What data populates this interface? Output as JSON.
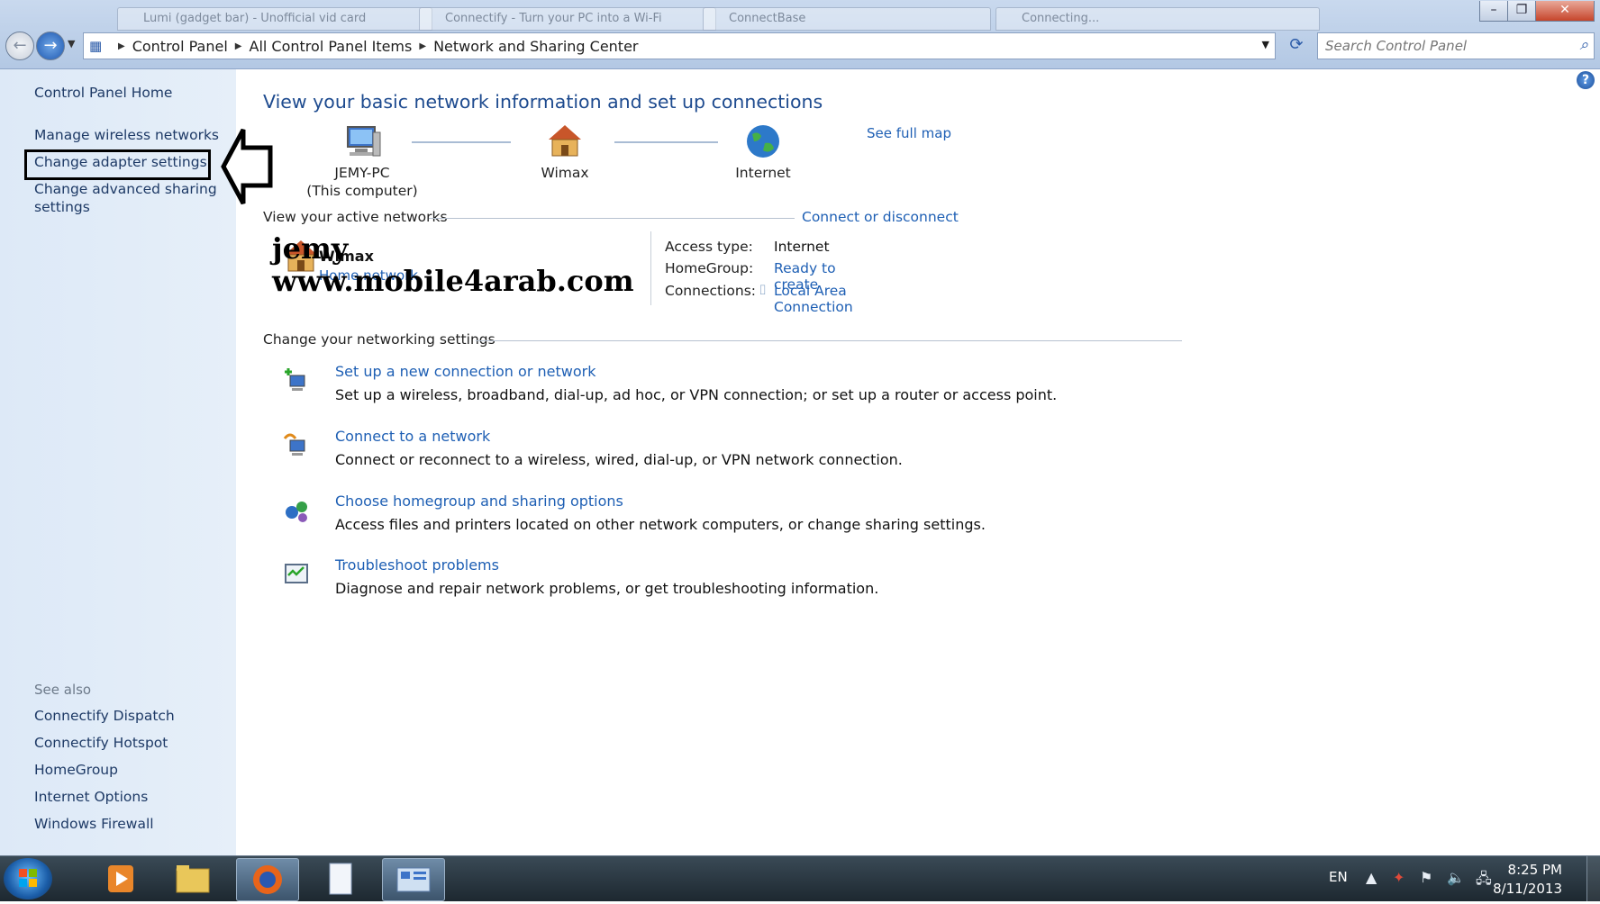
{
  "window": {
    "tabs": [
      "Lumi (gadget bar) - Unofficial vid card",
      "Connectify - Turn your PC into a Wi-Fi",
      "ConnectBase",
      "Connecting..."
    ],
    "minimize": "–",
    "maximize": "❐",
    "close": "✕"
  },
  "address": {
    "crumbs": [
      "Control Panel",
      "All Control Panel Items",
      "Network and Sharing Center"
    ],
    "search_placeholder": "Search Control Panel"
  },
  "sidebar": {
    "home": "Control Panel Home",
    "links": [
      "Manage wireless networks",
      "Change adapter settings",
      "Change advanced sharing",
      "settings"
    ],
    "see_also_title": "See also",
    "see_also": [
      "Connectify Dispatch",
      "Connectify Hotspot",
      "HomeGroup",
      "Internet Options",
      "Windows Firewall"
    ]
  },
  "main": {
    "title": "View your basic network information and set up connections",
    "see_full_map": "See full map",
    "map": {
      "computer_name": "JEMY-PC",
      "computer_sub": "(This computer)",
      "network": "Wimax",
      "internet": "Internet"
    },
    "active_networks_head": "View your active networks",
    "connect_disconnect": "Connect or disconnect",
    "active": {
      "name": "Wimax",
      "type": "Home network",
      "access_type_label": "Access type:",
      "access_type": "Internet",
      "homegroup_label": "HomeGroup:",
      "homegroup": "Ready to create",
      "connections_label": "Connections:",
      "connection": "Local Area Connection"
    },
    "watermark": {
      "line1": "jemy",
      "line2": "www.mobile4arab.com"
    },
    "settings_head": "Change your networking settings",
    "tasks": [
      {
        "title": "Set up a new connection or network",
        "desc": "Set up a wireless, broadband, dial-up, ad hoc, or VPN connection; or set up a router or access point."
      },
      {
        "title": "Connect to a network",
        "desc": "Connect or reconnect to a wireless, wired, dial-up, or VPN network connection."
      },
      {
        "title": "Choose homegroup and sharing options",
        "desc": "Access files and printers located on other network computers, or change sharing settings."
      },
      {
        "title": "Troubleshoot problems",
        "desc": "Diagnose and repair network problems, or get troubleshooting information."
      }
    ]
  },
  "taskbar": {
    "lang": "EN",
    "time": "8:25 PM",
    "date": "8/11/2013"
  },
  "colors": {
    "link": "#1e5fb4",
    "title": "#1e4b8f",
    "sidebar_bg": "#dde9f7"
  }
}
